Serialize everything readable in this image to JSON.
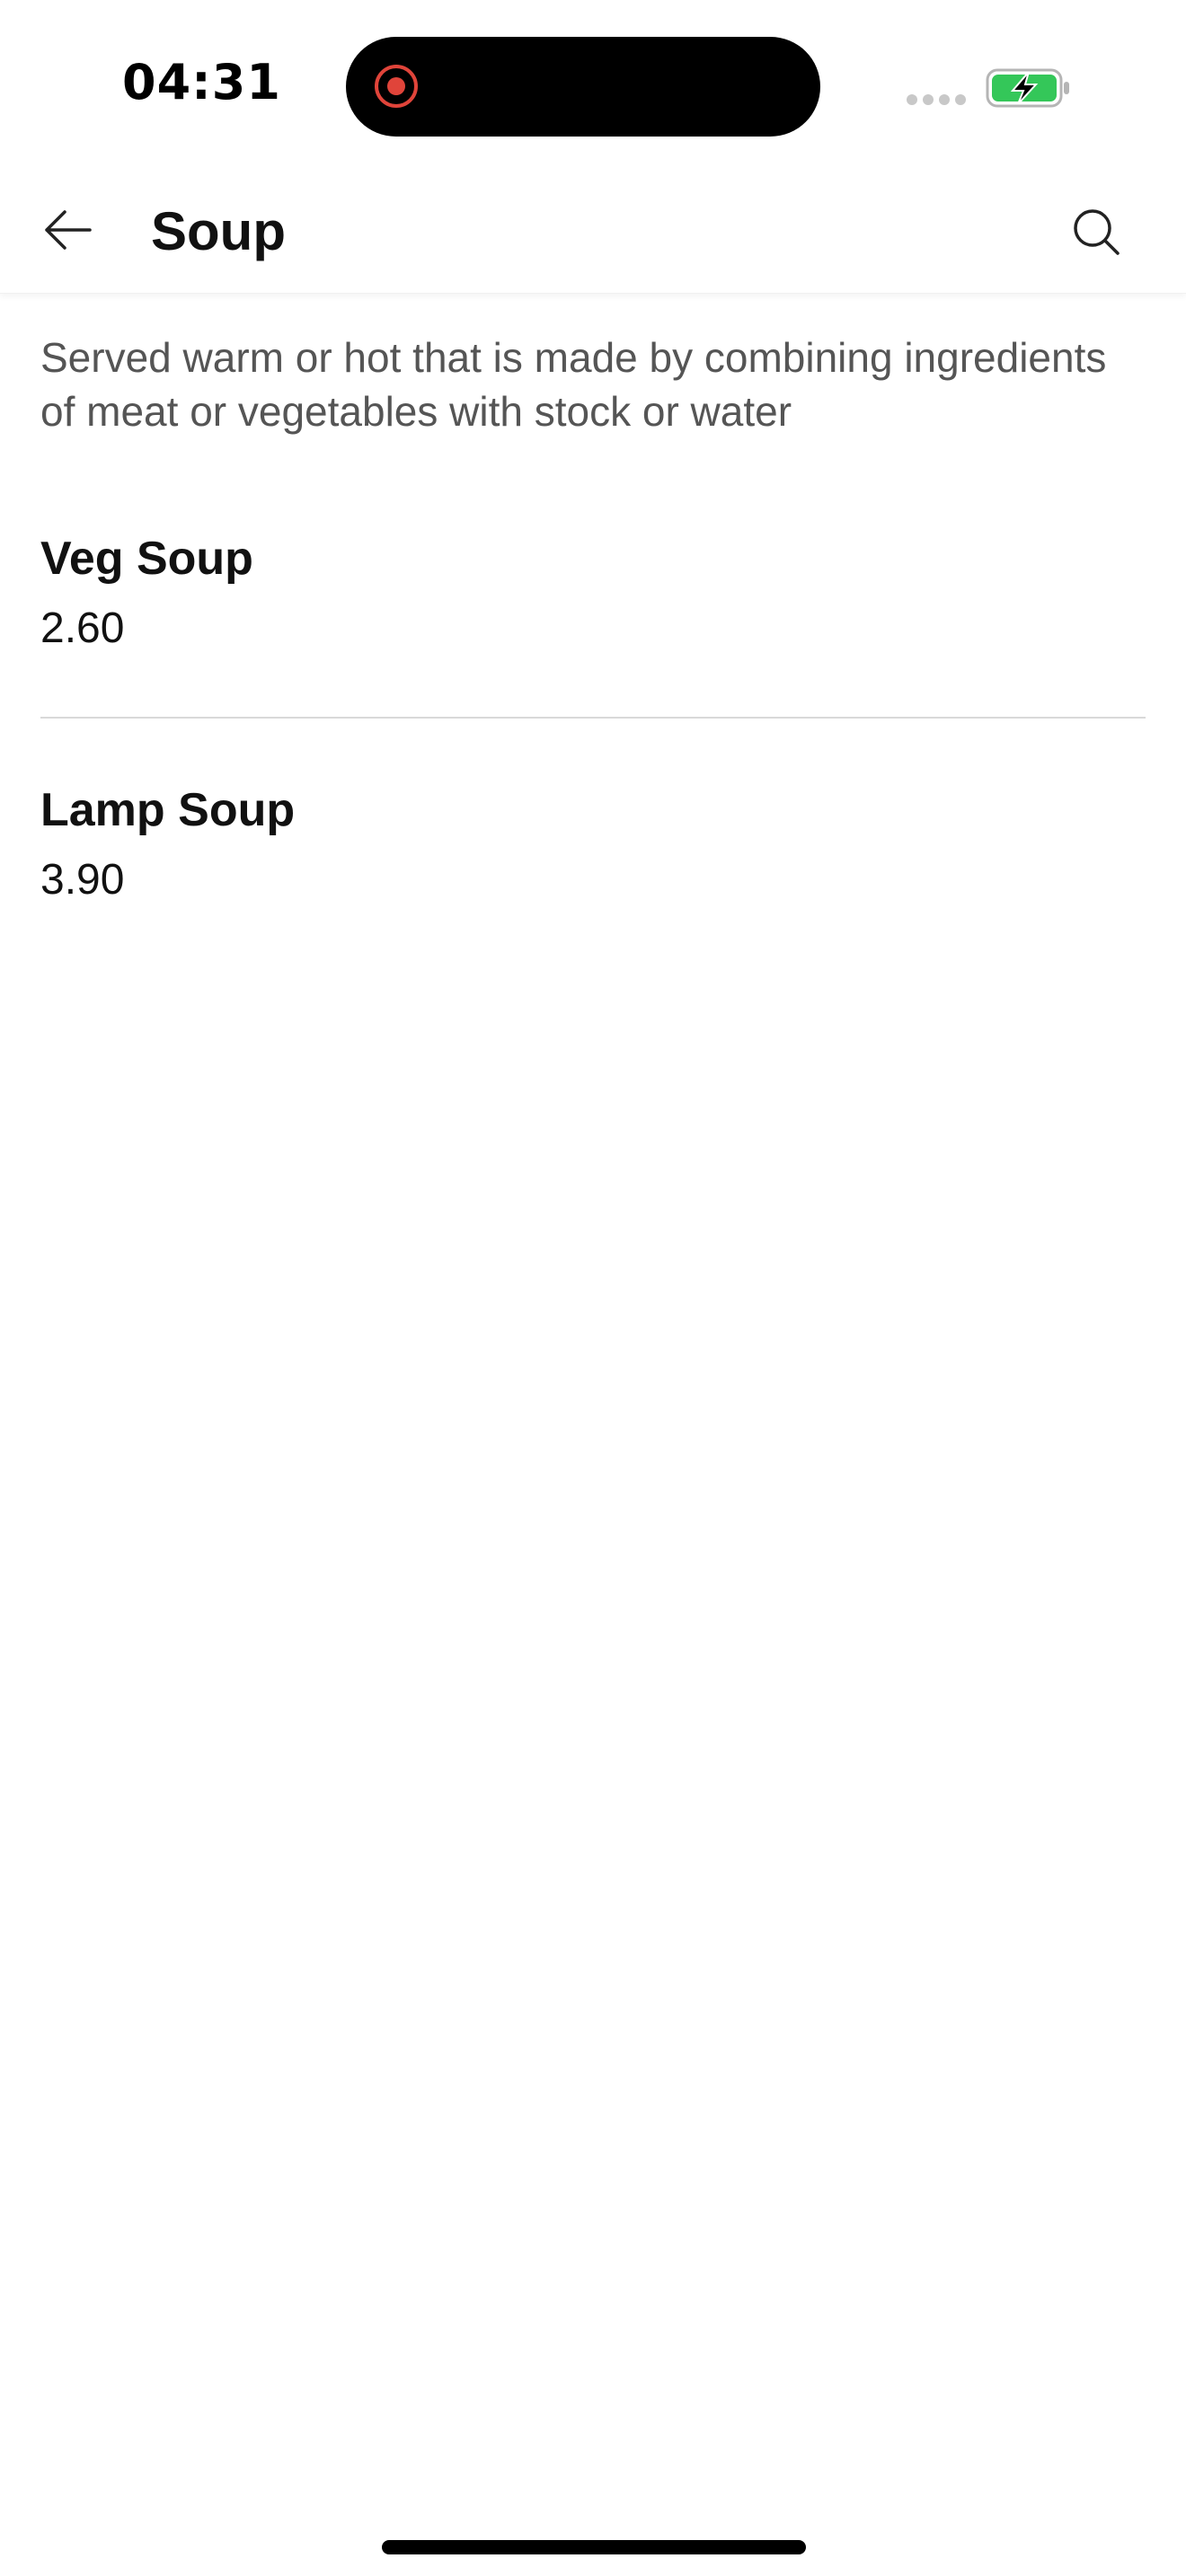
{
  "status_bar": {
    "time": "04:31",
    "recording_icon": "recording-indicator-icon",
    "signal_icon": "cellular-signal-icon",
    "battery_icon": "battery-charging-icon",
    "battery_color": "#34c759"
  },
  "header": {
    "back_icon": "arrow-left-icon",
    "title": "Soup",
    "search_icon": "search-icon"
  },
  "category": {
    "description": "Served warm or hot that is made by combining ingredients of meat or vegetables with stock or water"
  },
  "items": [
    {
      "name": "Veg Soup",
      "price": "2.60"
    },
    {
      "name": "Lamp Soup",
      "price": "3.90"
    }
  ]
}
